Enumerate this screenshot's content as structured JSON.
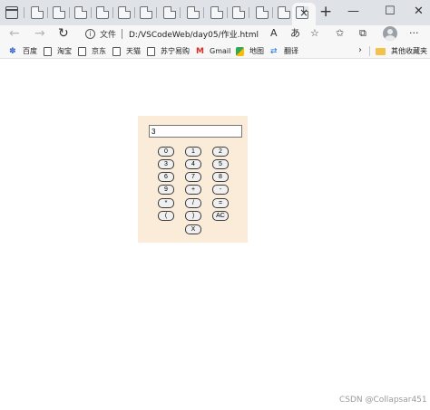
{
  "window": {
    "new_tab_label": "+",
    "close_tab_label": "×",
    "minimize_label": "—",
    "maximize_label": "☐",
    "close_label": "✕"
  },
  "addressbar": {
    "back_label": "←",
    "forward_label": "→",
    "reload_label": "↻",
    "info_label": "i",
    "scheme_label": "文件",
    "url": "D:/VSCodeWeb/day05/作业.html",
    "read_aloud_label": "A",
    "translate_label": "あ",
    "favorite_label": "☆",
    "favorites_label": "✩",
    "collections_label": "⧉",
    "more_label": "···"
  },
  "bookmarks": {
    "items": [
      {
        "label": "百度",
        "icon": "paw-icon"
      },
      {
        "label": "淘宝",
        "icon": "page-icon"
      },
      {
        "label": "京东",
        "icon": "page-icon"
      },
      {
        "label": "天猫",
        "icon": "page-icon"
      },
      {
        "label": "苏宁易购",
        "icon": "page-icon"
      },
      {
        "label": "Gmail",
        "icon": "gmail-icon"
      },
      {
        "label": "地图",
        "icon": "map-icon"
      },
      {
        "label": "翻译",
        "icon": "translate-icon"
      }
    ],
    "overflow_label": "›",
    "other_folder": "其他收藏夹"
  },
  "calculator": {
    "display_value": "3",
    "keys": [
      "0",
      "1",
      "2",
      "3",
      "4",
      "5",
      "6",
      "7",
      "8",
      "9",
      "+",
      "-",
      "*",
      "/",
      "=",
      "(",
      ")",
      "AC",
      "X"
    ]
  },
  "watermark": "CSDN @Collapsar451",
  "colors": {
    "calculator_background": "#fbebd9",
    "tabstrip_background": "#dfe3e8",
    "toolbar_background": "#f7f7f7"
  }
}
